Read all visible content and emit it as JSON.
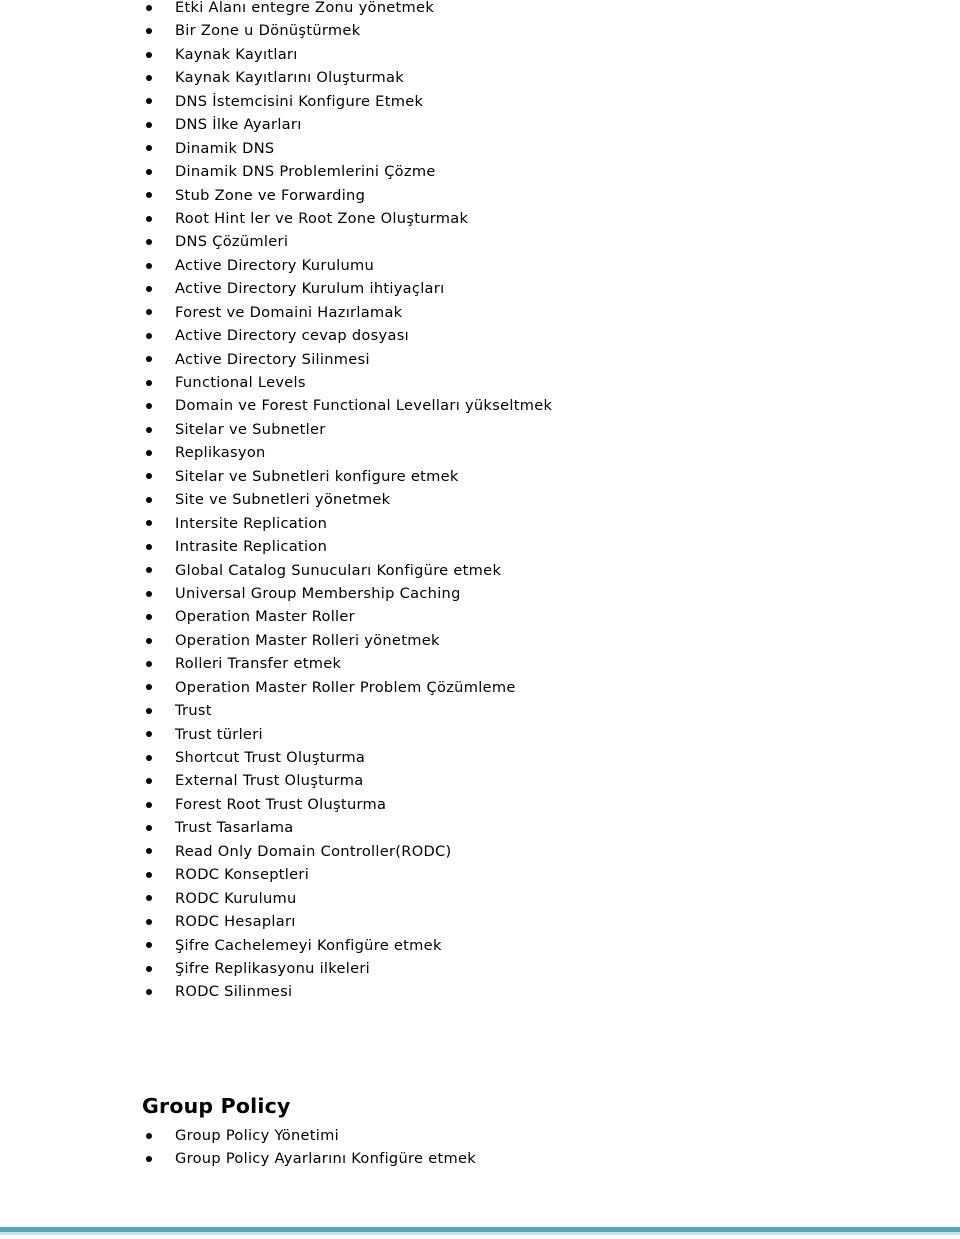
{
  "document": {
    "type": "course-outline",
    "language": "tr",
    "background_color": "#ffffff",
    "text_color": "#000000",
    "accent_color": "#56a5bd"
  },
  "main_list": {
    "bullet_glyph": "•",
    "items": [
      "Etki Alanı entegre Zonu yönetmek",
      "Bir Zone u Dönüştürmek",
      "Kaynak Kayıtları",
      "Kaynak Kayıtlarını Oluşturmak",
      "DNS İstemcisini Konfigure Etmek",
      "DNS İlke Ayarları",
      "Dinamik DNS",
      "Dinamik DNS Problemlerini Çözme",
      "Stub Zone ve Forwarding",
      "Root Hint ler ve Root Zone Oluşturmak",
      "DNS Çözümleri",
      "Active Directory Kurulumu",
      "Active Directory Kurulum ihtiyaçları",
      "Forest ve Domaini Hazırlamak",
      "Active Directory cevap dosyası",
      "Active Directory Silinmesi",
      "Functional Levels",
      "Domain ve Forest Functional Levelları yükseltmek",
      "Sitelar ve Subnetler",
      "Replikasyon",
      "Sitelar ve Subnetleri konfigure etmek",
      "Site ve Subnetleri yönetmek",
      "Intersite Replication",
      "Intrasite Replication",
      "Global Catalog Sunucuları Konfigüre etmek",
      "Universal Group Membership Caching",
      "Operation Master Roller",
      "Operation Master Rolleri yönetmek",
      "Rolleri Transfer etmek",
      "Operation Master Roller Problem Çözümleme",
      "Trust",
      "Trust türleri",
      "Shortcut Trust Oluşturma",
      "External Trust Oluşturma",
      "Forest Root Trust Oluşturma",
      "Trust Tasarlama",
      "Read Only Domain Controller(RODC)",
      "RODC Konseptleri",
      "RODC Kurulumu",
      "RODC Hesapları",
      "Şifre Cachelemeyi Konfigüre etmek",
      "Şifre Replikasyonu ilkeleri",
      "RODC Silinmesi"
    ]
  },
  "group_policy_section": {
    "heading": "Group Policy",
    "bullet_glyph": "•",
    "items": [
      "Group Policy Yönetimi",
      "Group Policy Ayarlarını Konfigüre etmek"
    ]
  }
}
